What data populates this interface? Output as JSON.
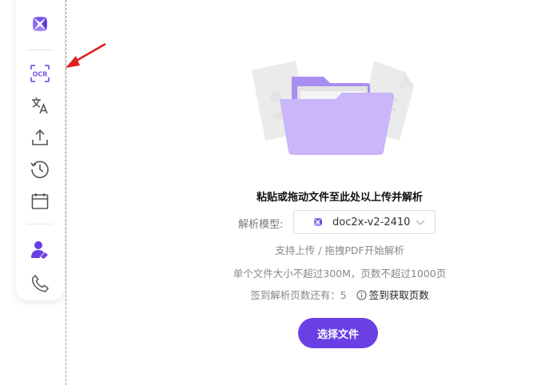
{
  "sidebar": {
    "items": [
      {
        "name": "logo",
        "icon": "doc2x-logo-icon"
      },
      {
        "name": "ocr",
        "icon": "ocr-scan-icon",
        "label": "OCR"
      },
      {
        "name": "translate",
        "icon": "translate-icon"
      },
      {
        "name": "upload",
        "icon": "upload-icon"
      },
      {
        "name": "history",
        "icon": "history-icon"
      },
      {
        "name": "calendar",
        "icon": "calendar-icon"
      },
      {
        "name": "user",
        "icon": "user-icon"
      },
      {
        "name": "contact",
        "icon": "phone-icon"
      }
    ]
  },
  "main": {
    "drop_title": "粘贴或拖动文件至此处以上传并解析",
    "model_label": "解析模型:",
    "model_value": "doc2x-v2-2410",
    "hint_upload": "支持上传 / 拖拽PDF开始解析",
    "hint_limits": "单个文件大小不超过300M，页数不超过1000页",
    "quota_text": "签到解析页数还有：5",
    "quota_link": "签到获取页数",
    "select_button": "选择文件"
  },
  "colors": {
    "accent": "#6a40e4",
    "icon_purple": "#7a57e6",
    "folder_light": "#c9b6fb",
    "folder_dark": "#a98ef2",
    "annotation_arrow": "#e02020"
  }
}
